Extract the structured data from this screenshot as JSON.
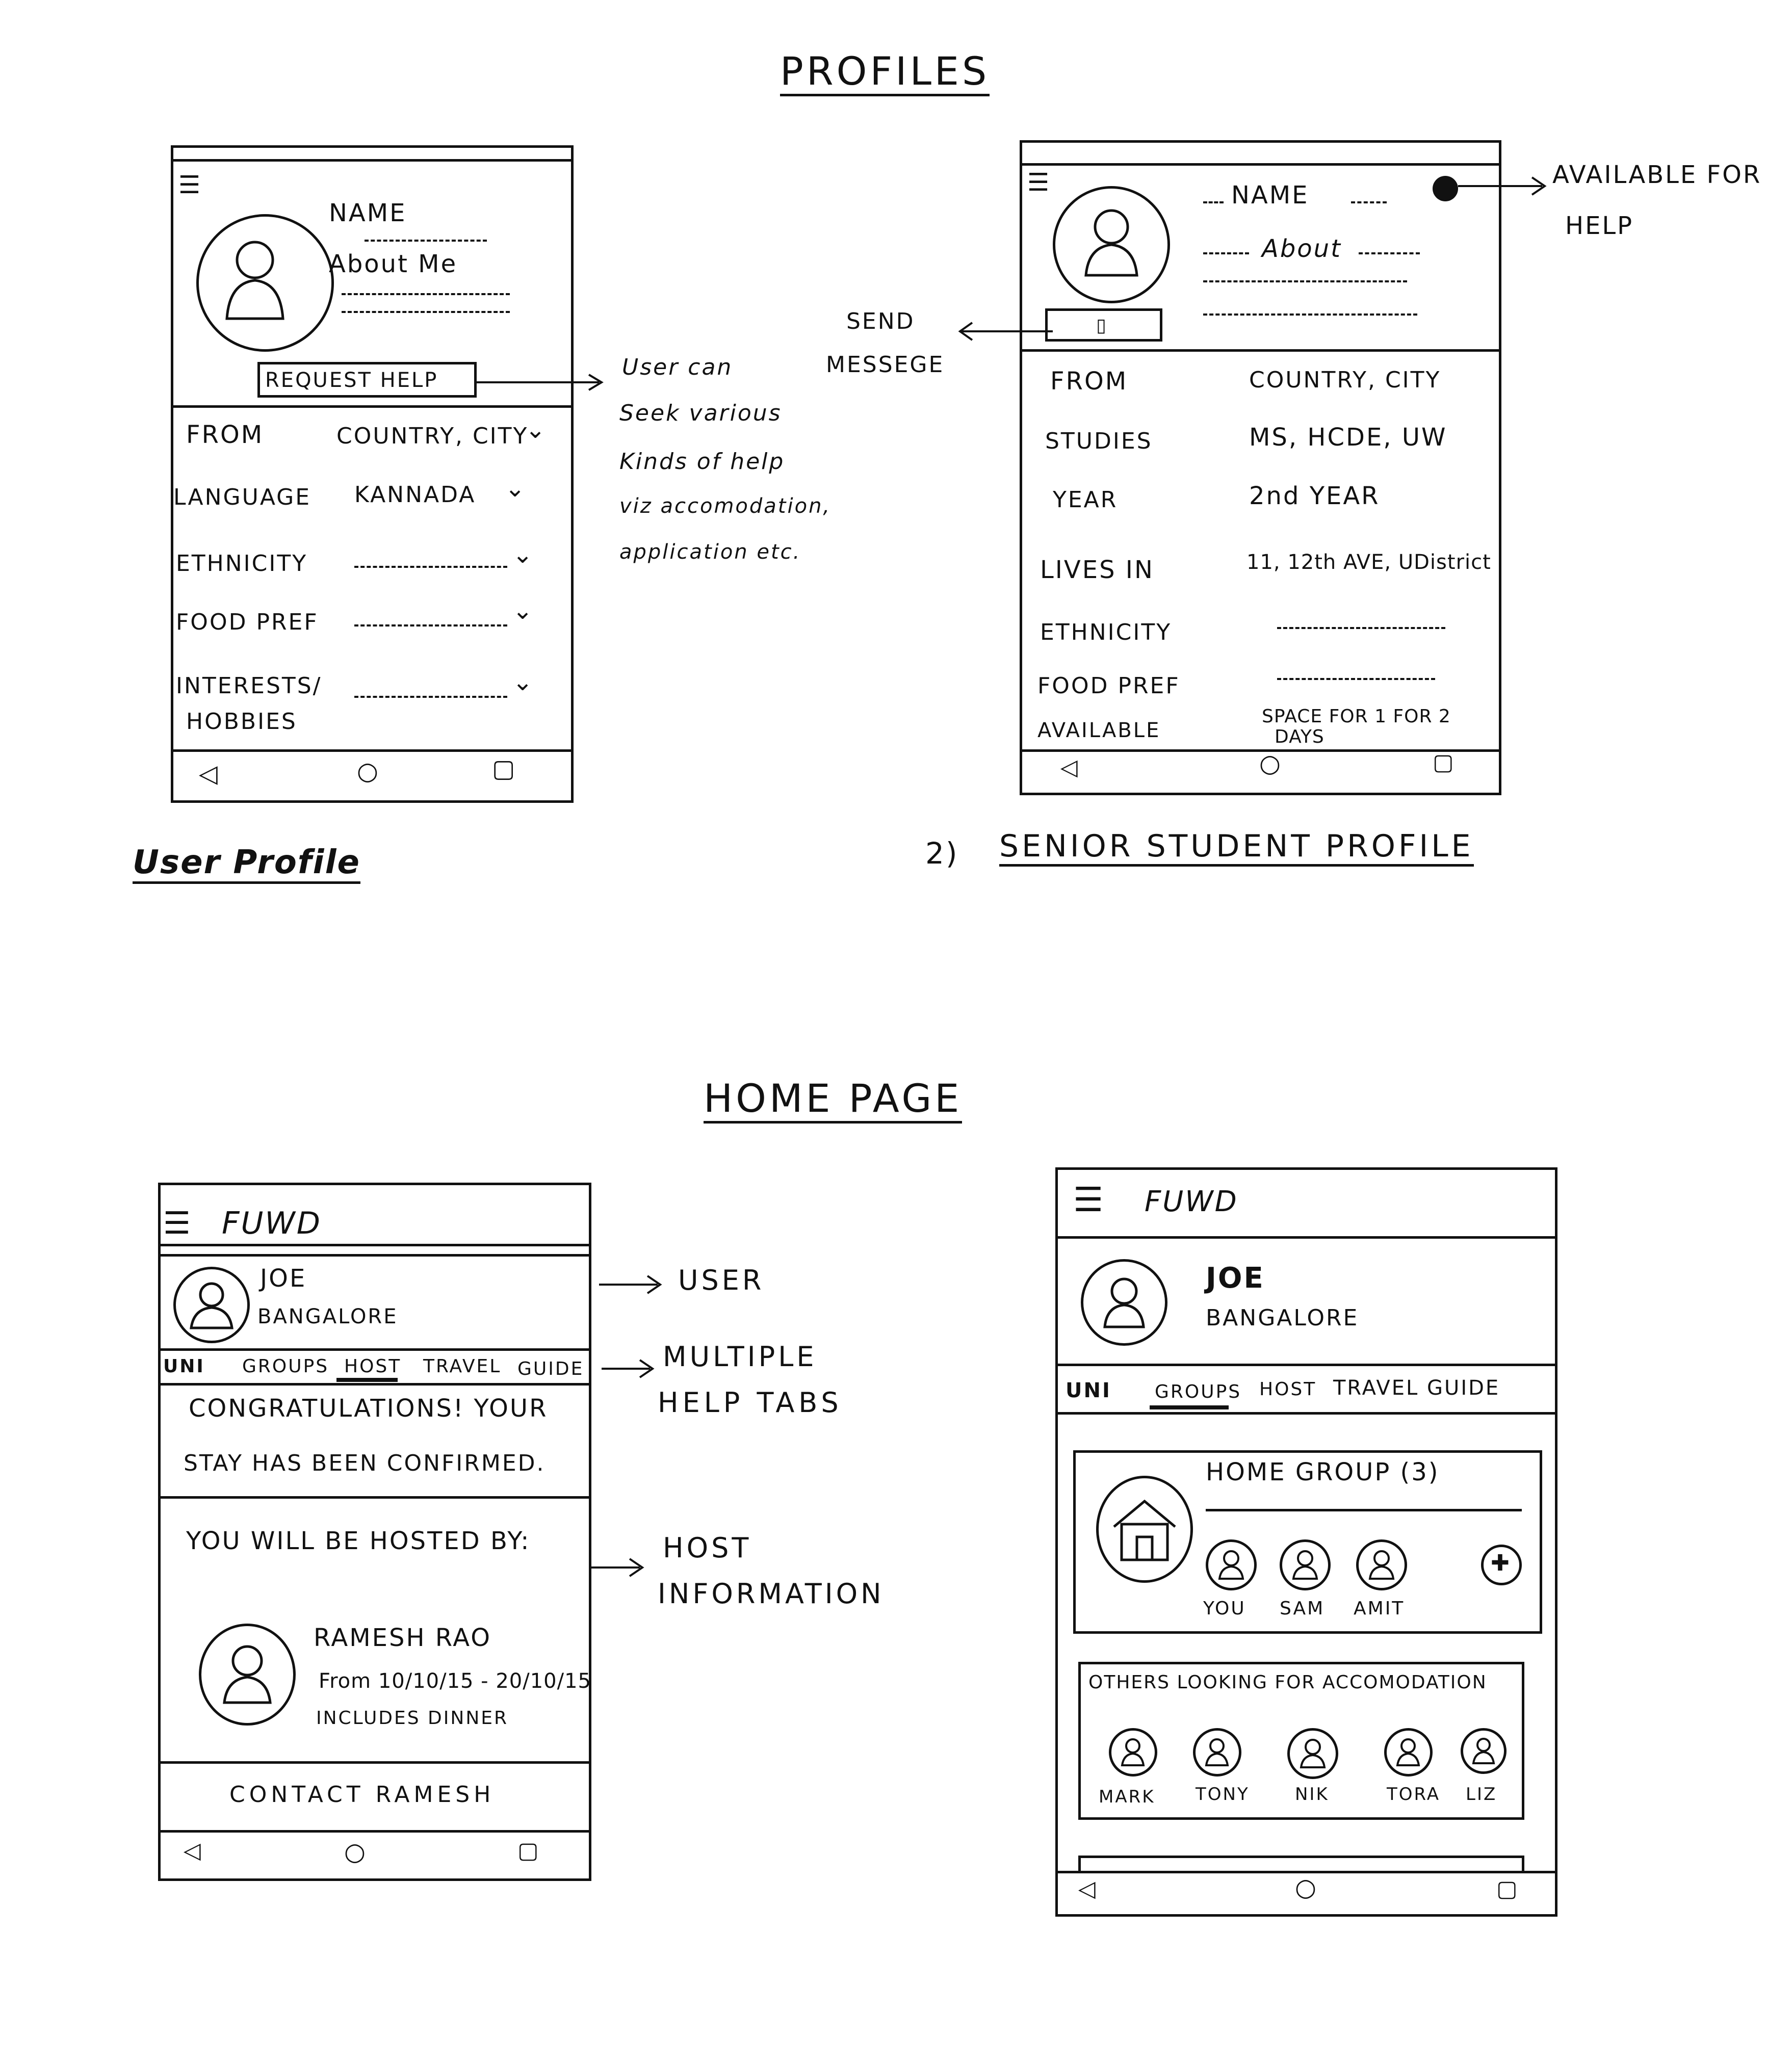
{
  "titles": {
    "profiles": "PROFILES",
    "home_page": "HOME PAGE"
  },
  "user_profile": {
    "caption": "User Profile",
    "name_label": "NAME",
    "about_label": "About Me",
    "request_help_button": "REQUEST HELP",
    "fields": [
      {
        "label": "FROM",
        "value": "COUNTRY, CITY"
      },
      {
        "label": "LANGUAGE",
        "value": "KANNADA"
      },
      {
        "label": "ETHNICITY",
        "value": ""
      },
      {
        "label": "FOOD PREF",
        "value": ""
      },
      {
        "label": "INTERESTS/",
        "label2": "HOBBIES",
        "value": ""
      }
    ],
    "annotation": [
      "User can",
      "Seek various",
      "Kinds of help",
      "viz accomodation,",
      "application etc."
    ]
  },
  "senior_profile": {
    "caption_prefix": "2)",
    "caption": "SENIOR STUDENT PROFILE",
    "name_label": "NAME",
    "about_label": "About",
    "send_message_annotation": [
      "SEND",
      "MESSEGE"
    ],
    "available_annotation": [
      "AVAILABLE FOR",
      "HELP"
    ],
    "fields": [
      {
        "label": "FROM",
        "value": "COUNTRY, CITY"
      },
      {
        "label": "STUDIES",
        "value": "MS, HCDE, UW"
      },
      {
        "label": "YEAR",
        "value": "2nd YEAR"
      },
      {
        "label": "LIVES IN",
        "value": "11, 12th AVE, UDistrict"
      },
      {
        "label": "ETHNICITY",
        "value": ""
      },
      {
        "label": "FOOD PREF",
        "value": ""
      },
      {
        "label": "AVAILABLE",
        "value": "SPACE FOR 1 FOR 2",
        "value2": "DAYS"
      }
    ]
  },
  "home_left": {
    "app_name": "FUWD",
    "user_name": "JOE",
    "user_city": "BANGALORE",
    "tabs": [
      "UNI",
      "GROUPS",
      "HOST",
      "TRAVEL",
      "GUIDE"
    ],
    "active_tab": "HOST",
    "congrats_line1": "CONGRATULATIONS! YOUR",
    "congrats_line2": "STAY HAS BEEN CONFIRMED.",
    "hosted_by": "YOU WILL BE HOSTED BY:",
    "host_name": "RAMESH RAO",
    "host_dates": "From 10/10/15 - 20/10/15",
    "host_includes": "INCLUDES DINNER",
    "contact_button": "CONTACT RAMESH",
    "annotations": {
      "user": "USER",
      "tabs": [
        "MULTIPLE",
        "HELP TABS"
      ],
      "host": [
        "HOST",
        "INFORMATION"
      ]
    }
  },
  "home_right": {
    "app_name": "FUWD",
    "user_name": "JOE",
    "user_city": "BANGALORE",
    "tabs": [
      "UNI",
      "GROUPS",
      "HOST",
      "TRAVEL GUIDE"
    ],
    "active_tab": "GROUPS",
    "group_title": "HOME GROUP (3)",
    "group_members": [
      "YOU",
      "SAM",
      "AMIT"
    ],
    "others_title": "OTHERS LOOKING FOR ACCOMODATION",
    "others": [
      "MARK",
      "TONY",
      "NIK",
      "TORA",
      "LIZ"
    ]
  }
}
